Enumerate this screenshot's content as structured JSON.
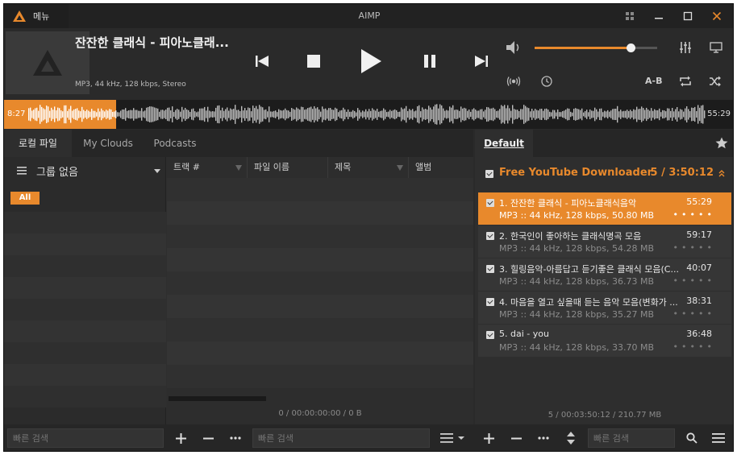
{
  "titlebar": {
    "menu": "메뉴",
    "app_title": "AIMP"
  },
  "player": {
    "track_title": "잔잔한 클래식 - 피아노클래...",
    "track_info": "MP3, 44 kHz, 128 kbps, Stereo",
    "volume": 0.78,
    "ab_label": "A-B",
    "progress": 0.153
  },
  "waveform": {
    "time_left": "8:27",
    "time_right": "55:29"
  },
  "library": {
    "tabs": [
      "로컬 파일",
      "My Clouds",
      "Podcasts"
    ],
    "group_label": "그룹 없음",
    "all_badge": "All",
    "columns": [
      "트랙 #",
      "파일 이름",
      "제목",
      "앨범"
    ],
    "status": "0 / 00:00:00:00 / 0 B",
    "search_placeholder": "빠른 검색",
    "search_placeholder_2": "빠른 검색"
  },
  "playlist": {
    "tab": "Default",
    "group_name": "Free YouTube Downloader",
    "group_count": "5 / 3:50:12",
    "tracks": [
      {
        "name": "1. 잔잔한 클래식 - 피아노클래식음악",
        "duration": "55:29",
        "meta": "MP3 :: 44 kHz, 128 kbps, 50.80 MB"
      },
      {
        "name": "2. 한국인이 좋아하는 클래식명곡 모음",
        "duration": "59:17",
        "meta": "MP3 :: 44 kHz, 128 kbps, 54.28 MB"
      },
      {
        "name": "3. 힐링음악-아름답고 듣기좋은 클래식 모음(C...",
        "duration": "40:07",
        "meta": "MP3 :: 44 kHz, 128 kbps, 36.73 MB"
      },
      {
        "name": "4. 마음을 열고 싶을때 듣는 음악 모음(변화가 ...",
        "duration": "38:31",
        "meta": "MP3 :: 44 kHz, 128 kbps, 35.27 MB"
      },
      {
        "name": "5. dai - you",
        "duration": "36:48",
        "meta": "MP3 :: 44 kHz, 128 kbps, 33.70 MB"
      }
    ],
    "status": "5 / 00:03:50:12 / 210.77 MB",
    "search_placeholder": "빠른 검색"
  },
  "colors": {
    "accent": "#e8892c",
    "background": "#2a2a2a"
  }
}
